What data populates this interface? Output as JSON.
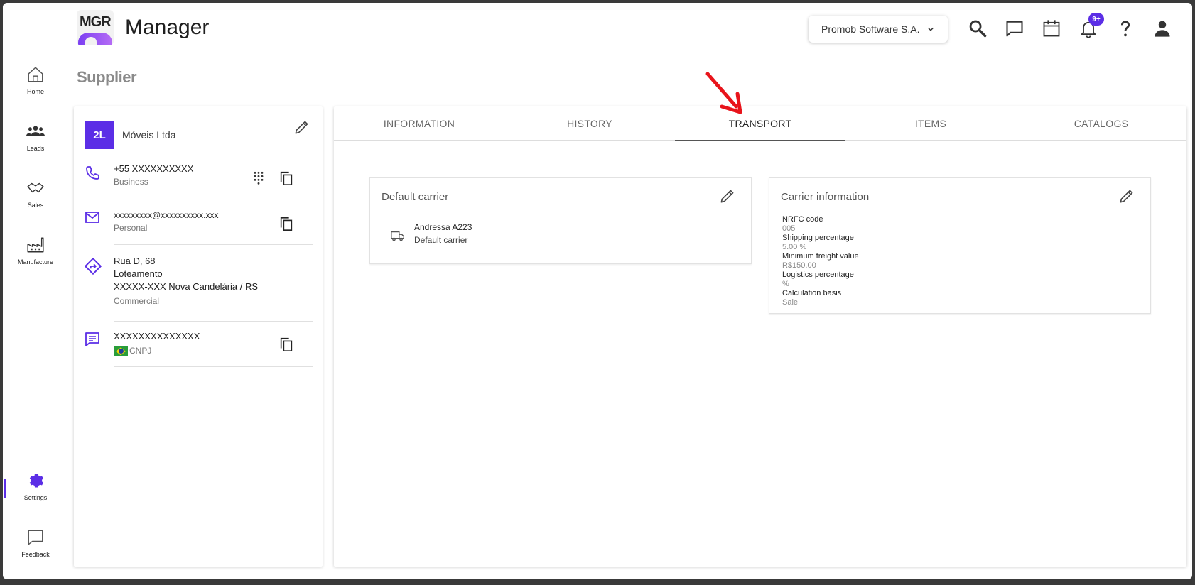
{
  "header": {
    "logo_text": "MGR",
    "app_title": "Manager",
    "company_selector": "Promob Software S.A.",
    "notifications_badge": "9+"
  },
  "sidebar": {
    "items": [
      {
        "label": "Home",
        "icon": "home-icon"
      },
      {
        "label": "Leads",
        "icon": "people-icon"
      },
      {
        "label": "Sales",
        "icon": "handshake-icon"
      },
      {
        "label": "Manufacture",
        "icon": "factory-icon"
      },
      {
        "label": "Settings",
        "icon": "gear-icon"
      },
      {
        "label": "Feedback",
        "icon": "feedback-icon"
      }
    ]
  },
  "page": {
    "title": "Supplier"
  },
  "supplier": {
    "avatar": "2L",
    "name": "Móveis Ltda",
    "phone": {
      "value": "+55 XXXXXXXXXX",
      "type": "Business"
    },
    "email": {
      "value": "xxxxxxxxx@xxxxxxxxxx.xxx",
      "type": "Personal"
    },
    "address": {
      "line1": "Rua D, 68",
      "line2": "Loteamento",
      "line3": "XXXXX-XXX Nova Candelária / RS",
      "type": "Commercial"
    },
    "document": {
      "value": "XXXXXXXXXXXXXX",
      "type": "CNPJ"
    }
  },
  "tabs": [
    {
      "label": "INFORMATION"
    },
    {
      "label": "HISTORY"
    },
    {
      "label": "TRANSPORT"
    },
    {
      "label": "ITEMS"
    },
    {
      "label": "CATALOGS"
    }
  ],
  "default_carrier": {
    "title": "Default carrier",
    "name": "Andressa A223",
    "subtitle": "Default carrier"
  },
  "carrier_information": {
    "title": "Carrier information",
    "fields": [
      {
        "label": "NRFC code",
        "value": "005"
      },
      {
        "label": "Shipping percentage",
        "value": "5.00 %"
      },
      {
        "label": "Minimum freight value",
        "value": "R$150.00"
      },
      {
        "label": "Logistics percentage",
        "value": "%"
      },
      {
        "label": "Calculation basis",
        "value": "Sale"
      }
    ]
  },
  "colors": {
    "accent": "#5b2ee6",
    "annotation_arrow": "#e8141b"
  }
}
